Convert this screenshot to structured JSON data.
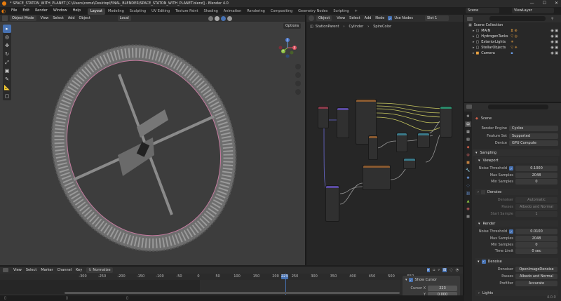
{
  "window": {
    "title": "* SPACE_STATON_WITH_PLANET [C:\\Users\\come\\Desktop\\FINAL_BLENDER\\SPACE_STATON_WITH_PLANET.blend] - Blender 4.0",
    "min": "—",
    "max": "☐",
    "close": "✕"
  },
  "menu": [
    "File",
    "Edit",
    "Render",
    "Window",
    "Help"
  ],
  "workspaces": [
    "Layout",
    "Modeling",
    "Sculpting",
    "UV Editing",
    "Texture Paint",
    "Shading",
    "Animation",
    "Rendering",
    "Compositing",
    "Geometry Nodes",
    "Scripting"
  ],
  "scene_field": "Scene",
  "viewlayer_field": "ViewLayer",
  "viewport": {
    "mode": "Object Mode",
    "menus": [
      "View",
      "Select",
      "Add",
      "Object"
    ],
    "transform": "Local",
    "options": "Options",
    "gizmo": {
      "x": "X",
      "y": "Y",
      "z": "Z"
    }
  },
  "node_editor": {
    "type": "Object",
    "menus": [
      "View",
      "Select",
      "Add",
      "Node"
    ],
    "use_nodes": "Use Nodes",
    "slot": "Slot 1",
    "breadcrumb": [
      "StationParent",
      "Cylinder",
      "SpireColor"
    ]
  },
  "outliner": {
    "title": "Scene Collection",
    "items": [
      {
        "name": "MAIN"
      },
      {
        "name": "HydrogenTanks"
      },
      {
        "name": "ExteriorLights"
      },
      {
        "name": "StellarObjects"
      },
      {
        "name": "Camera"
      }
    ]
  },
  "properties": {
    "breadcrumb": "Scene",
    "render_engine_label": "Render Engine",
    "render_engine": "Cycles",
    "feature_set_label": "Feature Set",
    "feature_set": "Supported",
    "device_label": "Device",
    "device": "GPU Compute",
    "sampling": "Sampling",
    "viewport": "Viewport",
    "noise_threshold_label": "Noise Threshold",
    "noise_threshold_vp": "0.1000",
    "max_samples_label": "Max Samples",
    "max_samples_vp": "2048",
    "min_samples_label": "Min Samples",
    "min_samples_vp": "0",
    "denoise": "Denoise",
    "denoiser_label": "Denoiser",
    "denoiser_vp": "Automatic",
    "passes_label": "Passes",
    "passes_vp": "Albedo and Normal",
    "start_sample_label": "Start Sample",
    "start_sample": "1",
    "render": "Render",
    "noise_threshold_r": "0.0100",
    "max_samples_r": "2048",
    "min_samples_r": "0",
    "time_limit_label": "Time Limit",
    "time_limit": "0 sec",
    "denoise_r": "Denoise",
    "denoiser_r": "OpenImageDenoise",
    "passes_r": "Albedo and Normal",
    "prefilter_label": "Prefilter",
    "prefilter": "Accurate",
    "lights": "Lights"
  },
  "timeline": {
    "menus": [
      "View",
      "Select",
      "Marker",
      "Channel",
      "Key"
    ],
    "normalize": "Normalize",
    "ticks": [
      "-300",
      "-250",
      "-200",
      "-150",
      "-100",
      "-50",
      "0",
      "50",
      "100",
      "150",
      "200",
      "250",
      "300",
      "350",
      "400",
      "450",
      "500",
      "550"
    ],
    "current_frame": "223",
    "show_cursor": "Show Cursor",
    "cursor_x_label": "Cursor X",
    "cursor_x": "223",
    "cursor_y_label": "Y",
    "cursor_y": "0.000"
  },
  "version": "4.0.0"
}
